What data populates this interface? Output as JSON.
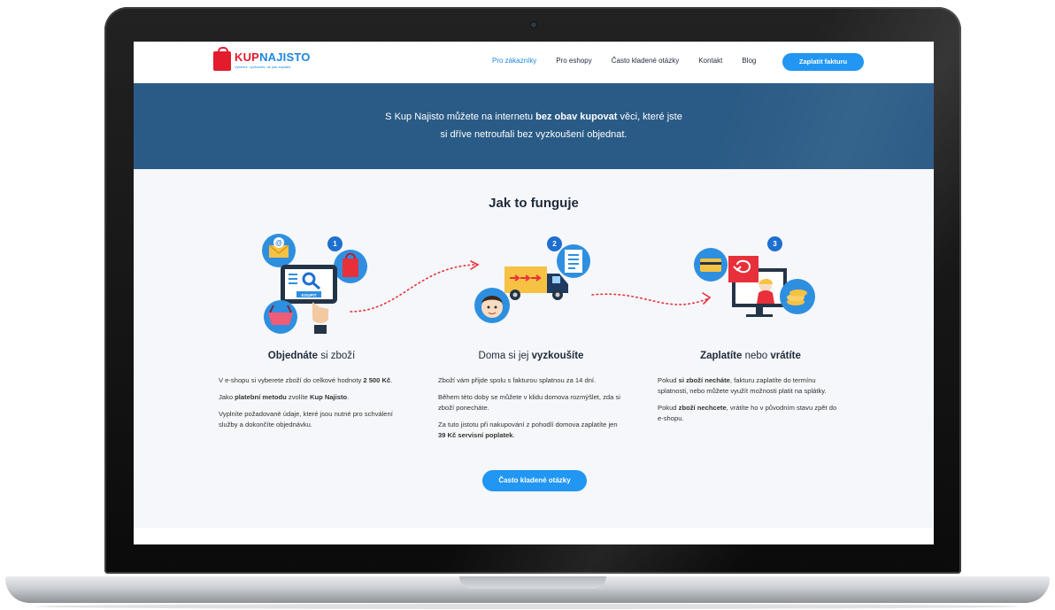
{
  "header": {
    "logo": {
      "kup": "KUP",
      "najisto": "NAJISTO",
      "tagline": "Vyberež, vyzkoušíš, až pak zaplatíš"
    },
    "nav": [
      "Pro zákazníky",
      "Pro eshopy",
      "Často kladené otázky",
      "Kontakt",
      "Blog"
    ],
    "cta": "Zaplatit fakturu"
  },
  "hero": {
    "line1_a": "S Kup Najisto můžete na internetu ",
    "line1_b": "bez obav kupovat",
    "line1_c": " věci, které jste",
    "line2": "si dříve netroufali bez vyzkoušení objednat."
  },
  "how": {
    "title": "Jak to funguje",
    "steps": [
      {
        "number": "1",
        "title_bold": "Objednáte",
        "title_rest": " si zboží",
        "p1_a": "V e-shopu si vyberete zboží do celkové hodnoty ",
        "p1_b": "2 500 Kč",
        "p1_c": ".",
        "p2_a": "Jako ",
        "p2_b": "platební metodu",
        "p2_c": " zvolíte ",
        "p2_d": "Kup Najisto",
        "p2_e": ".",
        "p3": "Vyplníte požadované údaje, které jsou nutné pro schválení služby a dokončíte objednávku.",
        "icon_label": "KOUPIT"
      },
      {
        "number": "2",
        "title_rest": "Doma si jej ",
        "title_bold": "vyzkoušíte",
        "p1": "Zboží vám přijde spolu s fakturou splatnou za 14 dní.",
        "p2": "Během této doby se můžete v klidu domova rozmýšlet, zda si zboží ponecháte.",
        "p3_a": "Za tuto jistotu při nakupování z pohodlí domova zaplatíte jen ",
        "p3_b": "39 Kč servisní poplatek",
        "p3_c": "."
      },
      {
        "number": "3",
        "title_bold": "Zaplatíte",
        "title_mid": " nebo ",
        "title_bold2": "vrátíte",
        "p1_a": "Pokud ",
        "p1_b": "si zboží necháte",
        "p1_c": ", fakturu zaplatíte do termínu splatnosti, nebo můžete využít možnosti platit na splátky.",
        "p2_a": "Pokud ",
        "p2_b": "zboží nechcete",
        "p2_c": ", vrátíte ho v původním stavu zpět do e-shopu."
      }
    ],
    "faq_button": "Často kladené otázky"
  },
  "colors": {
    "accent": "#2196f3",
    "hero": "#2a5b86",
    "brand_red": "#e31b2c",
    "dots": "#e8303a"
  }
}
